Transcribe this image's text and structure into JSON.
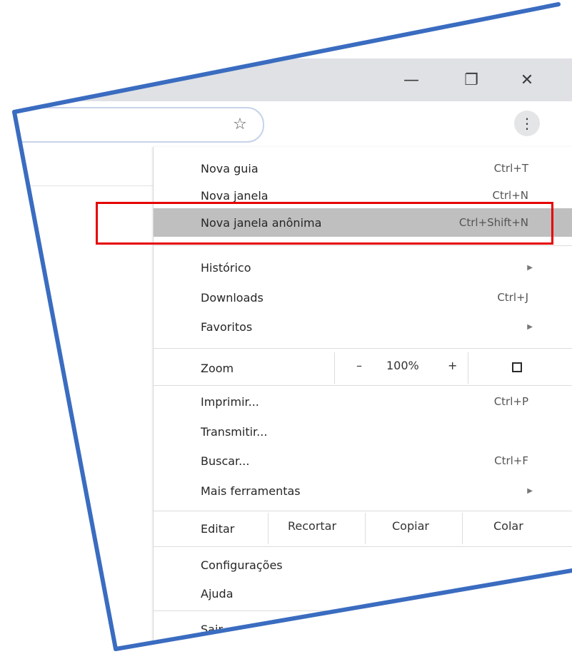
{
  "window": {
    "minimize_glyph": "—",
    "restore_glyph": "❐",
    "close_glyph": "✕"
  },
  "toolbar": {
    "bookmark_icon": "☆",
    "menu_icon": "⋮"
  },
  "menu": {
    "items": [
      {
        "label": "Nova guia",
        "shortcut": "Ctrl+T"
      },
      {
        "label": "Nova janela",
        "shortcut": "Ctrl+N"
      },
      {
        "label": "Nova janela anônima",
        "shortcut": "Ctrl+Shift+N"
      },
      {
        "label": "Histórico",
        "submenu": "▶"
      },
      {
        "label": "Downloads",
        "shortcut": "Ctrl+J"
      },
      {
        "label": "Favoritos",
        "submenu": "▶"
      },
      {
        "label": "Imprimir...",
        "shortcut": "Ctrl+P"
      },
      {
        "label": "Transmitir..."
      },
      {
        "label": "Buscar...",
        "shortcut": "Ctrl+F"
      },
      {
        "label": "Mais ferramentas",
        "submenu": "▶"
      },
      {
        "label": "Configurações"
      },
      {
        "label": "Ajuda"
      },
      {
        "label": "Sair"
      }
    ],
    "zoom": {
      "label": "Zoom",
      "decrease": "–",
      "value": "100%",
      "increase": "+"
    },
    "edit": {
      "label": "Editar",
      "cut": "Recortar",
      "copy": "Copiar",
      "paste": "Colar"
    }
  },
  "colors": {
    "highlight_border": "#e60000",
    "frame_border": "#3a6cc0",
    "hover_row": "#bfbfbf",
    "titlebar": "#dfe1e5"
  }
}
